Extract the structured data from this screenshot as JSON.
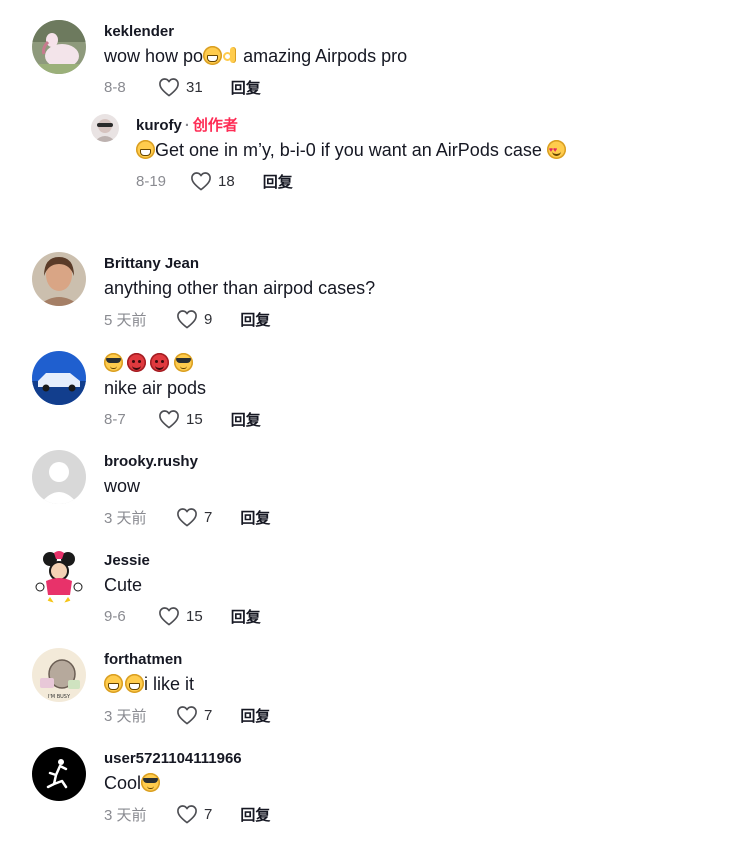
{
  "ui": {
    "reply_label": "回复",
    "creator_label": "创作者",
    "separator": "·"
  },
  "comments": [
    {
      "username": "keklender",
      "text": "wow how po",
      "text_after": "amazing Airpods pro",
      "date": "8-8",
      "likes": "31",
      "reply": {
        "username": "kurofy",
        "text": "Get one in m’y, b-i-0 if you want an AirPods case",
        "date": "8-19",
        "likes": "18"
      }
    },
    {
      "username": "Brittany Jean",
      "text": "anything other than airpod cases?",
      "date": "5 天前",
      "likes": "9"
    },
    {
      "username": "",
      "text": "nike air pods",
      "date": "8-7",
      "likes": "15"
    },
    {
      "username": "brooky.rushy",
      "text": "wow",
      "date": "3 天前",
      "likes": "7"
    },
    {
      "username": "Jessie",
      "text": "Cute",
      "date": "9-6",
      "likes": "15"
    },
    {
      "username": "forthatmen",
      "text": "i like it",
      "date": "3 天前",
      "likes": "7",
      "avatar_text": "I'M BUSY"
    },
    {
      "username": "user5721104111966",
      "text": "Cool",
      "date": "3 天前",
      "likes": "7"
    }
  ],
  "colors": {
    "creator": "#fe2c55",
    "meta": "#8a8b91",
    "text": "#161823"
  }
}
